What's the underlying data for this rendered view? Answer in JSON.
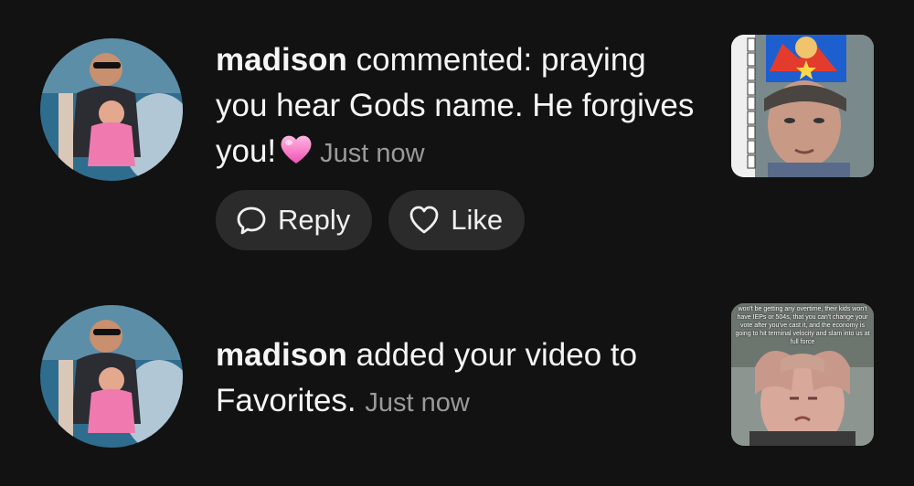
{
  "notifications": [
    {
      "username": "madison",
      "message": " commented: praying you hear Gods name. He forgives you!",
      "timestamp": "Just now",
      "emoji": "pink-heart",
      "actions": {
        "reply_label": "Reply",
        "like_label": "Like"
      },
      "thumbnail_icon": "video-thumbnail"
    },
    {
      "username": "madison",
      "message": " added your video to Favorites.",
      "timestamp": "Just now",
      "thumbnail_icon": "video-thumbnail",
      "thumbnail_caption": "won't be getting any overtime, their kids won't have IEPs or 504s, that you can't change your vote after you've cast it, and the economy is going to hit terminal velocity and slam into us at full force"
    }
  ],
  "colors": {
    "background": "#121212",
    "pill": "#2b2b2b",
    "timestamp": "#9a9a9a"
  }
}
